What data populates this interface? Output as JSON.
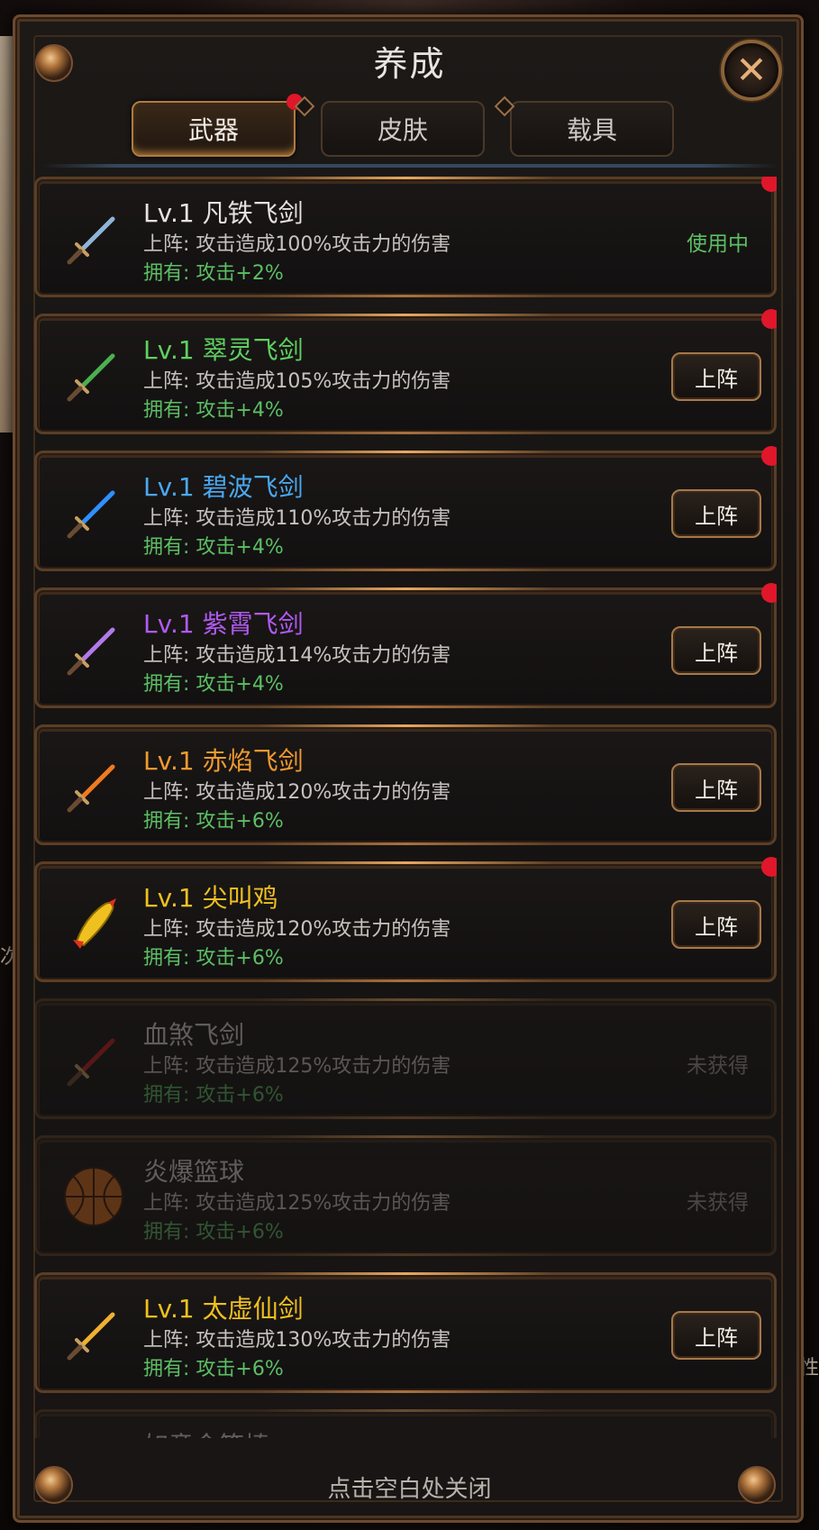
{
  "window": {
    "title": "养成",
    "close_label": "✕",
    "footer_hint": "点击空白处关闭"
  },
  "tabs": [
    {
      "label": "武器",
      "active": true,
      "has_dot": true
    },
    {
      "label": "皮肤",
      "active": false,
      "has_dot": false
    },
    {
      "label": "载具",
      "active": false,
      "has_dot": false
    }
  ],
  "items": [
    {
      "name": "Lv.1 凡铁飞剑",
      "effect": "上阵: 攻击造成100%攻击力的伤害",
      "own": "拥有: 攻击+2%",
      "status": "使用中",
      "state": "inuse",
      "name_color": "#e6e2de",
      "icon": "iron-sword-icon",
      "blade": "#8fb4d8",
      "dot": true
    },
    {
      "name": "Lv.1 翠灵飞剑",
      "effect": "上阵: 攻击造成105%攻击力的伤害",
      "own": "拥有: 攻击+4%",
      "button": "上阵",
      "state": "equip",
      "name_color": "#5fd15f",
      "icon": "jade-sword-icon",
      "blade": "#4caf50",
      "dot": true
    },
    {
      "name": "Lv.1 碧波飞剑",
      "effect": "上阵: 攻击造成110%攻击力的伤害",
      "own": "拥有: 攻击+4%",
      "button": "上阵",
      "state": "equip",
      "name_color": "#4aa8f0",
      "icon": "wave-sword-icon",
      "blade": "#2f8fff",
      "dot": true
    },
    {
      "name": "Lv.1 紫霄飞剑",
      "effect": "上阵: 攻击造成114%攻击力的伤害",
      "own": "拥有: 攻击+4%",
      "button": "上阵",
      "state": "equip",
      "name_color": "#b05af0",
      "icon": "purple-sword-icon",
      "blade": "#b07ae8",
      "dot": true
    },
    {
      "name": "Lv.1 赤焰飞剑",
      "effect": "上阵: 攻击造成120%攻击力的伤害",
      "own": "拥有: 攻击+6%",
      "button": "上阵",
      "state": "equip",
      "name_color": "#f09a30",
      "icon": "flame-sword-icon",
      "blade": "#f07a20",
      "dot": false
    },
    {
      "name": "Lv.1 尖叫鸡",
      "effect": "上阵: 攻击造成120%攻击力的伤害",
      "own": "拥有: 攻击+6%",
      "button": "上阵",
      "state": "equip",
      "name_color": "#f0c020",
      "icon": "screaming-chicken-icon",
      "blade": "#f0c020",
      "dot": true
    },
    {
      "name": "血煞飞剑",
      "effect": "上阵: 攻击造成125%攻击力的伤害",
      "own": "拥有: 攻击+6%",
      "status": "未获得",
      "state": "locked",
      "name_color": "#d8d4d0",
      "icon": "blood-sword-icon",
      "blade": "#c02020",
      "dot": false
    },
    {
      "name": "炎爆篮球",
      "effect": "上阵: 攻击造成125%攻击力的伤害",
      "own": "拥有: 攻击+6%",
      "status": "未获得",
      "state": "locked",
      "name_color": "#d8d4d0",
      "icon": "basketball-icon",
      "blade": "#d2691e",
      "dot": false
    },
    {
      "name": "Lv.1 太虚仙剑",
      "effect": "上阵: 攻击造成130%攻击力的伤害",
      "own": "拥有: 攻击+6%",
      "button": "上阵",
      "state": "equip",
      "name_color": "#f0c020",
      "icon": "golden-sword-icon",
      "blade": "#f0b030",
      "dot": false
    },
    {
      "name": "如意金箍棒",
      "effect": "",
      "own": "",
      "state": "locked",
      "name_color": "#d8d4d0",
      "icon": "golden-staff-icon",
      "blade": "#d8a030",
      "dot": false
    }
  ],
  "background": {
    "left_text": "次",
    "right_text": "性"
  }
}
